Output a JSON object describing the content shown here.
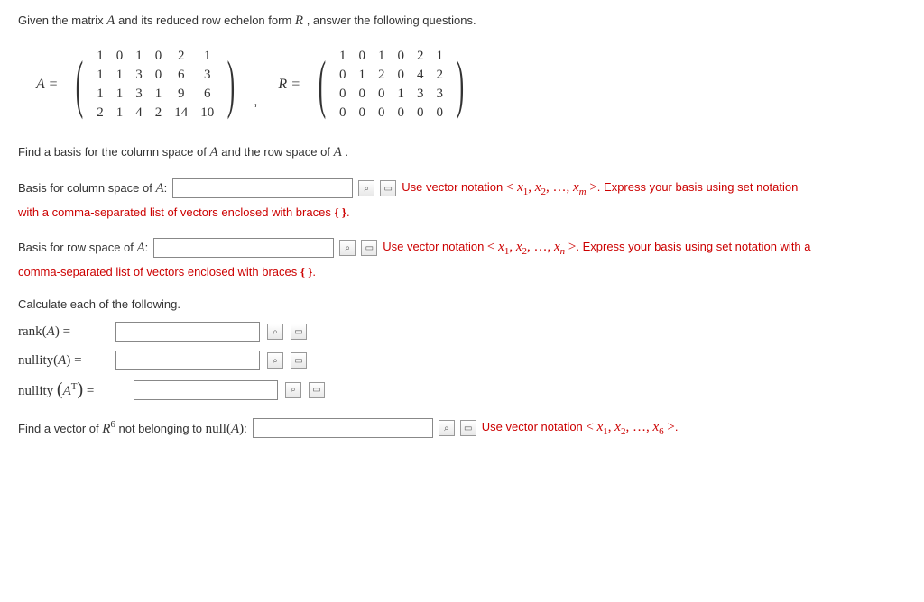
{
  "intro": "Given the matrix ",
  "intro_var1": "A",
  "intro_mid": " and its reduced row echelon form ",
  "intro_var2": "R",
  "intro_end": ", answer the following questions.",
  "matrixA_label": "A =",
  "matrixA": [
    [
      "1",
      "0",
      "1",
      "0",
      "2",
      "1"
    ],
    [
      "1",
      "1",
      "3",
      "0",
      "6",
      "3"
    ],
    [
      "1",
      "1",
      "3",
      "1",
      "9",
      "6"
    ],
    [
      "2",
      "1",
      "4",
      "2",
      "14",
      "10"
    ]
  ],
  "matrixR_label": "R =",
  "matrixR": [
    [
      "1",
      "0",
      "1",
      "0",
      "2",
      "1"
    ],
    [
      "0",
      "1",
      "2",
      "0",
      "4",
      "2"
    ],
    [
      "0",
      "0",
      "0",
      "1",
      "3",
      "3"
    ],
    [
      "0",
      "0",
      "0",
      "0",
      "0",
      "0"
    ]
  ],
  "find_basis": "Find a basis for the column space of ",
  "find_basis_var": "A",
  "find_basis_mid": " and the row space of ",
  "find_basis_var2": "A",
  "find_basis_end": ".",
  "col_basis_label": "Basis for column space of ",
  "col_basis_var": "A",
  "col_basis_colon": ":",
  "use_vector_prefix": "Use vector notation ",
  "vector_notation_m": "< x₁, x₂, …, xₘ >",
  "vector_notation_n": "< x₁, x₂, …, xₙ >",
  "vector_notation_6": "< x₁, x₂, …, x₆ >",
  "col_basis_suffix": ". Express your basis using set notation",
  "col_basis_line2_pre": "with a comma-separated list of vectors enclosed with braces ",
  "braces_text": "{ }",
  "col_basis_line2_post": ".",
  "row_basis_label": "Basis for row space of ",
  "row_basis_var": "A",
  "row_basis_colon": ":",
  "row_basis_suffix": ". Express your basis using set notation with a",
  "row_basis_line2_pre": "comma-separated list of vectors enclosed with braces ",
  "row_basis_line2_post": ".",
  "calc_heading": "Calculate each of the following.",
  "rank_label": "rank(A) =",
  "nullity_label": "nullity(A) =",
  "nullityT_pre": "nullity",
  "nullityT_paren": "(Aᵀ)",
  "nullityT_eq": " =",
  "find_vector_pre": "Find a vector of ",
  "find_vector_R6": "R⁶",
  "find_vector_mid": " not belonging to ",
  "find_vector_null": "null(A)",
  "find_vector_colon": ":",
  "find_vector_end": "."
}
